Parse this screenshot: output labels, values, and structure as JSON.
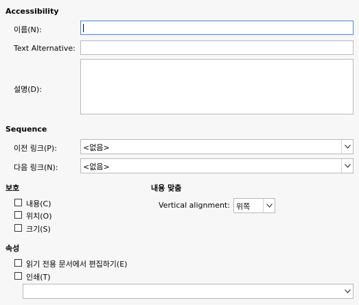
{
  "accessibility": {
    "heading": "Accessibility",
    "name_label": "이름(N):",
    "name_value": "",
    "alt_label": "Text Alternative:",
    "alt_value": "",
    "desc_label": "설명(D):",
    "desc_value": ""
  },
  "sequence": {
    "heading": "Sequence",
    "prev_label": "이전 링크(P):",
    "prev_value": "<없음>",
    "next_label": "다음 링크(N):",
    "next_value": "<없음>"
  },
  "protect": {
    "heading": "보호",
    "items": [
      {
        "label": "내용(C)",
        "checked": false
      },
      {
        "label": "위치(O)",
        "checked": false
      },
      {
        "label": "크기(S)",
        "checked": false
      }
    ]
  },
  "content_align": {
    "heading": "내용 맞춤",
    "valign_label": "Vertical alignment:",
    "valign_value": "위쪽"
  },
  "properties": {
    "heading": "속성",
    "edit_readonly_label": "읽기 전용 문서에서 편집하기(E)",
    "edit_readonly_checked": false,
    "print_label": "인쇄(T)",
    "print_checked": false,
    "dropdown_value": ""
  }
}
